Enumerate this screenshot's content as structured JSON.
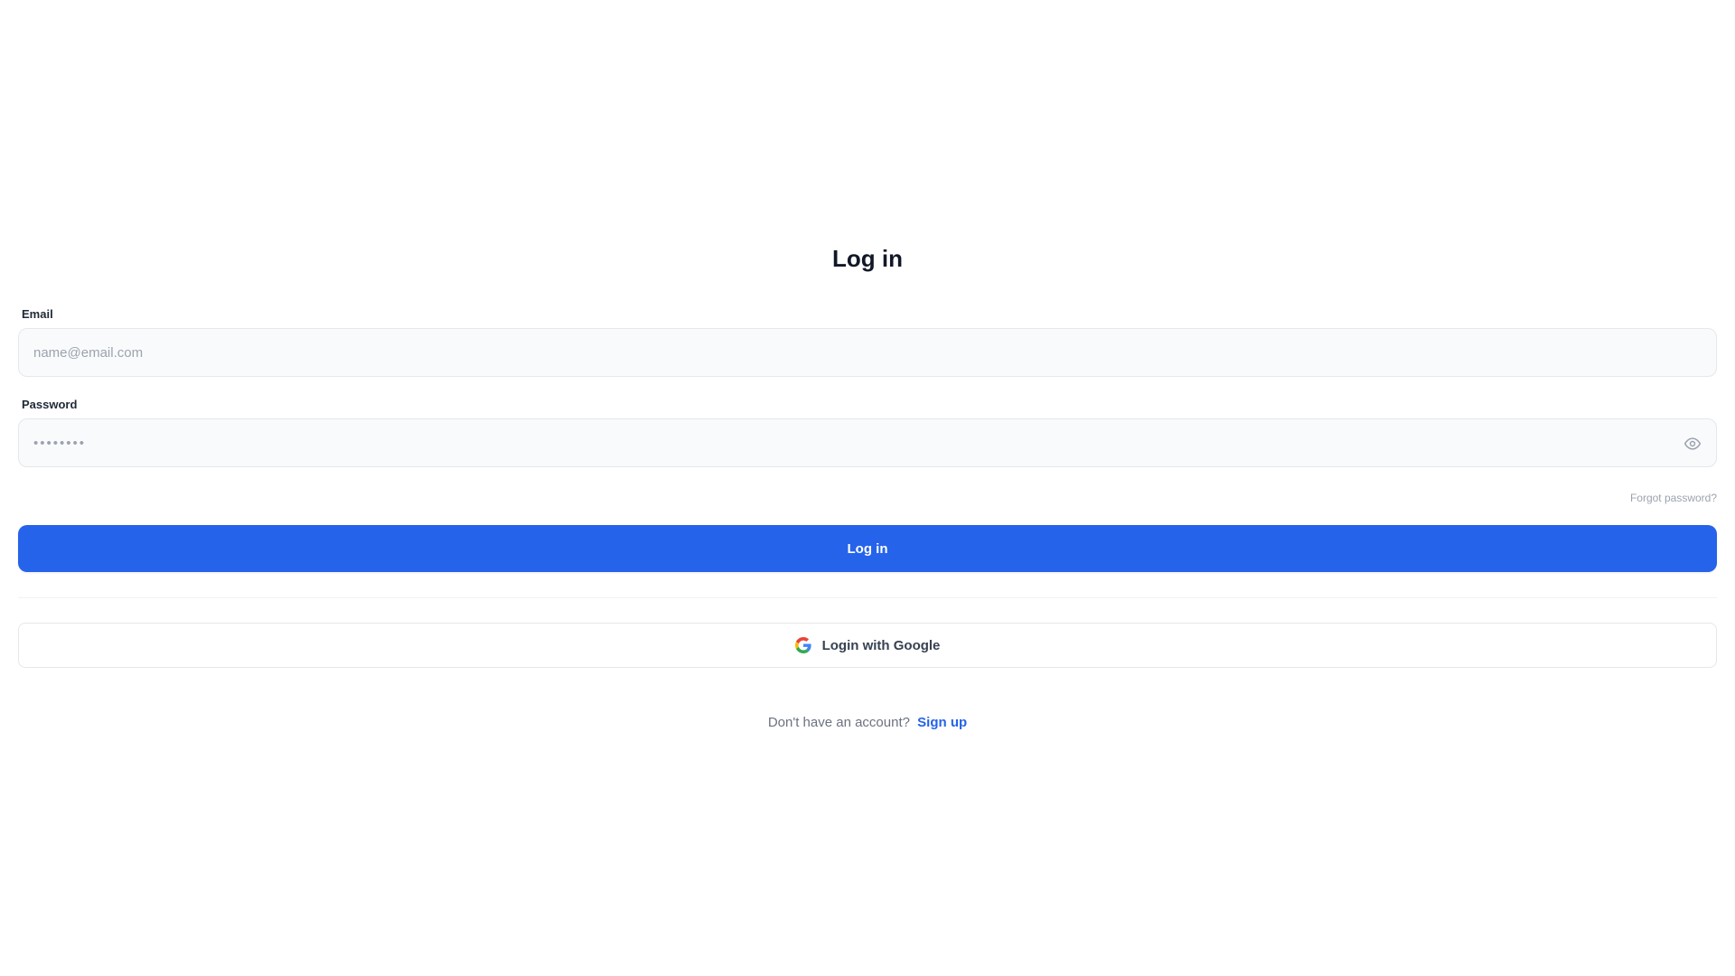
{
  "page": {
    "title": "Log in"
  },
  "form": {
    "email": {
      "label": "Email",
      "value": "",
      "placeholder": "name@email.com"
    },
    "password": {
      "label": "Password",
      "value": "••••••••",
      "placeholder": "",
      "toggle_icon": "eye-icon"
    },
    "forgot_password_label": "Forgot password?",
    "submit_label": "Log in",
    "google_label": "Login with Google",
    "google_icon": "google-icon"
  },
  "footer": {
    "prompt": "Don't have an account?",
    "signup_label": "Sign up"
  },
  "colors": {
    "primary": "#2563eb",
    "input_bg": "#f9fafb",
    "border": "#e5e7eb",
    "muted_text": "#9ca3af",
    "body_text": "#6b7280",
    "heading": "#111827"
  }
}
